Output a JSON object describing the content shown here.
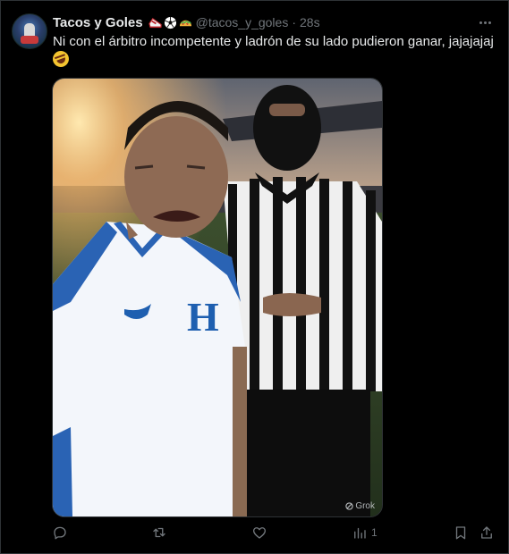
{
  "post": {
    "author_name": "Tacos y Goles",
    "handle": "@tacos_y_goles",
    "separator": "·",
    "time": "28s",
    "text": "Ni con el árbitro incompetente y ladrón de su lado pudieron ganar, jajajajaj",
    "media": {
      "watermark": "Grok"
    },
    "emoji_icons": [
      "soccer-shoe-icon",
      "soccer-ball-icon",
      "taco-icon"
    ]
  },
  "actions": {
    "reply_count": "",
    "repost_count": "",
    "like_count": "",
    "views_count": "1"
  },
  "colors": {
    "background": "#000000",
    "text_primary": "#e7e9ea",
    "text_secondary": "#71767b",
    "border": "#2f3336"
  }
}
